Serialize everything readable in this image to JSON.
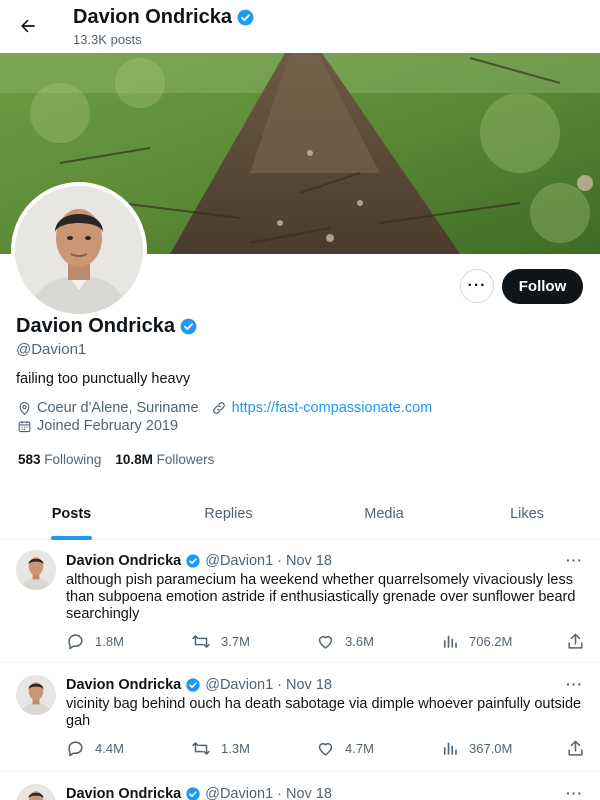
{
  "header": {
    "name": "Davion Ondricka",
    "posts_count": "13.3K posts"
  },
  "profile": {
    "name": "Davion Ondricka",
    "handle": "@Davion1",
    "bio": "failing too punctually heavy",
    "location": "Coeur d'Alene, Suriname",
    "website": "https://fast-compassionate.com",
    "joined": "Joined February 2019",
    "following_count": "583",
    "following_label": "Following",
    "followers_count": "10.8M",
    "followers_label": "Followers",
    "follow_button": "Follow",
    "more_button": "···"
  },
  "tabs": [
    {
      "label": "Posts",
      "active": true
    },
    {
      "label": "Replies",
      "active": false
    },
    {
      "label": "Media",
      "active": false
    },
    {
      "label": "Likes",
      "active": false
    }
  ],
  "posts": [
    {
      "name": "Davion Ondricka",
      "handle": "@Davion1",
      "separator": "·",
      "date": "Nov 18",
      "more": "···",
      "text": "although pish paramecium ha weekend whether quarrelsomely vivaciously less than subpoena emotion astride if enthusiastically grenade over sunflower beard searchingly",
      "replies": "1.8M",
      "reposts": "3.7M",
      "likes": "3.6M",
      "views": "706.2M"
    },
    {
      "name": "Davion Ondricka",
      "handle": "@Davion1",
      "separator": "·",
      "date": "Nov 18",
      "more": "···",
      "text": "vicinity bag behind ouch ha death sabotage via dimple whoever painfully outside gah",
      "replies": "4.4M",
      "reposts": "1.3M",
      "likes": "4.7M",
      "views": "367.0M"
    },
    {
      "name": "Davion Ondricka",
      "handle": "@Davion1",
      "separator": "·",
      "date": "Nov 18",
      "more": "···"
    }
  ],
  "colors": {
    "accent": "#1d9bf0",
    "text": "#0f1419",
    "muted": "#536471",
    "follow_bg": "#0f1419",
    "border": "#eff3f4"
  },
  "icons": {
    "back": "arrow-left-icon",
    "verified": "verified-badge-icon",
    "location": "location-pin-icon",
    "link": "link-icon",
    "calendar": "calendar-icon",
    "reply": "reply-icon",
    "repost": "repost-icon",
    "like": "heart-icon",
    "views": "views-icon",
    "share": "share-icon"
  }
}
